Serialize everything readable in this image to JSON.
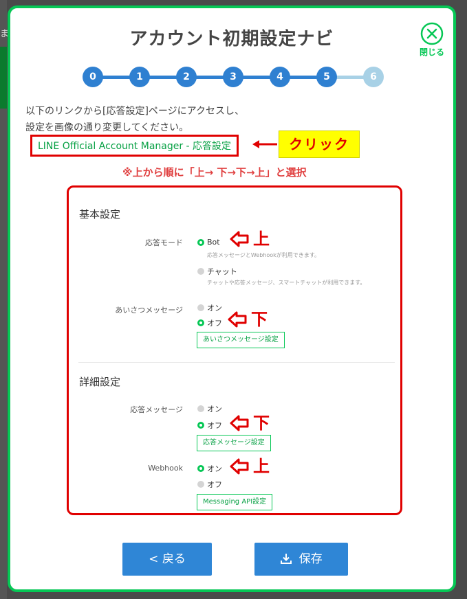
{
  "background": {
    "partial_char": "ま"
  },
  "modal": {
    "title": "アカウント初期設定ナビ",
    "close_label": "閉じる",
    "close_icon": "close-circle-icon"
  },
  "stepper": {
    "steps": [
      "0",
      "1",
      "2",
      "3",
      "4",
      "5",
      "6"
    ],
    "current_step": 5
  },
  "instructions": {
    "line1": "以下のリンクから[応答設定]ページにアクセスし、",
    "line2": "設定を画像の通り変更してください。"
  },
  "link": {
    "text": "LINE Official Account Manager - 応答設定"
  },
  "annotation": {
    "click_label": "クリック",
    "note": "※上から順に「上→ 下→下→上」と選択"
  },
  "settings": {
    "basic": {
      "title": "基本設定",
      "response_mode": {
        "label": "応答モード",
        "options": [
          {
            "label": "Bot",
            "selected": true,
            "desc": "応答メッセージとWebhookが利用できます。"
          },
          {
            "label": "チャット",
            "selected": false,
            "desc": "チャットや応答メッセージ、スマートチャットが利用できます。"
          }
        ],
        "anno": "上"
      },
      "greeting": {
        "label": "あいさつメッセージ",
        "options": [
          {
            "label": "オン",
            "selected": false
          },
          {
            "label": "オフ",
            "selected": true
          }
        ],
        "button": "あいさつメッセージ設定",
        "anno": "下"
      }
    },
    "detail": {
      "title": "詳細設定",
      "auto_response": {
        "label": "応答メッセージ",
        "options": [
          {
            "label": "オン",
            "selected": false
          },
          {
            "label": "オフ",
            "selected": true
          }
        ],
        "button": "応答メッセージ設定",
        "anno": "下"
      },
      "webhook": {
        "label": "Webhook",
        "options": [
          {
            "label": "オン",
            "selected": true
          },
          {
            "label": "オフ",
            "selected": false
          }
        ],
        "button": "Messaging API設定",
        "anno": "上"
      }
    }
  },
  "footer": {
    "back_label": "< 戻る",
    "save_label": "保存",
    "save_icon": "download-icon"
  },
  "colors": {
    "brand_green": "#06c755",
    "primary_blue": "#2f86d6",
    "annotation_red": "#e00000",
    "highlight_yellow": "#ffff00",
    "step_inactive": "#a8d1e6"
  }
}
